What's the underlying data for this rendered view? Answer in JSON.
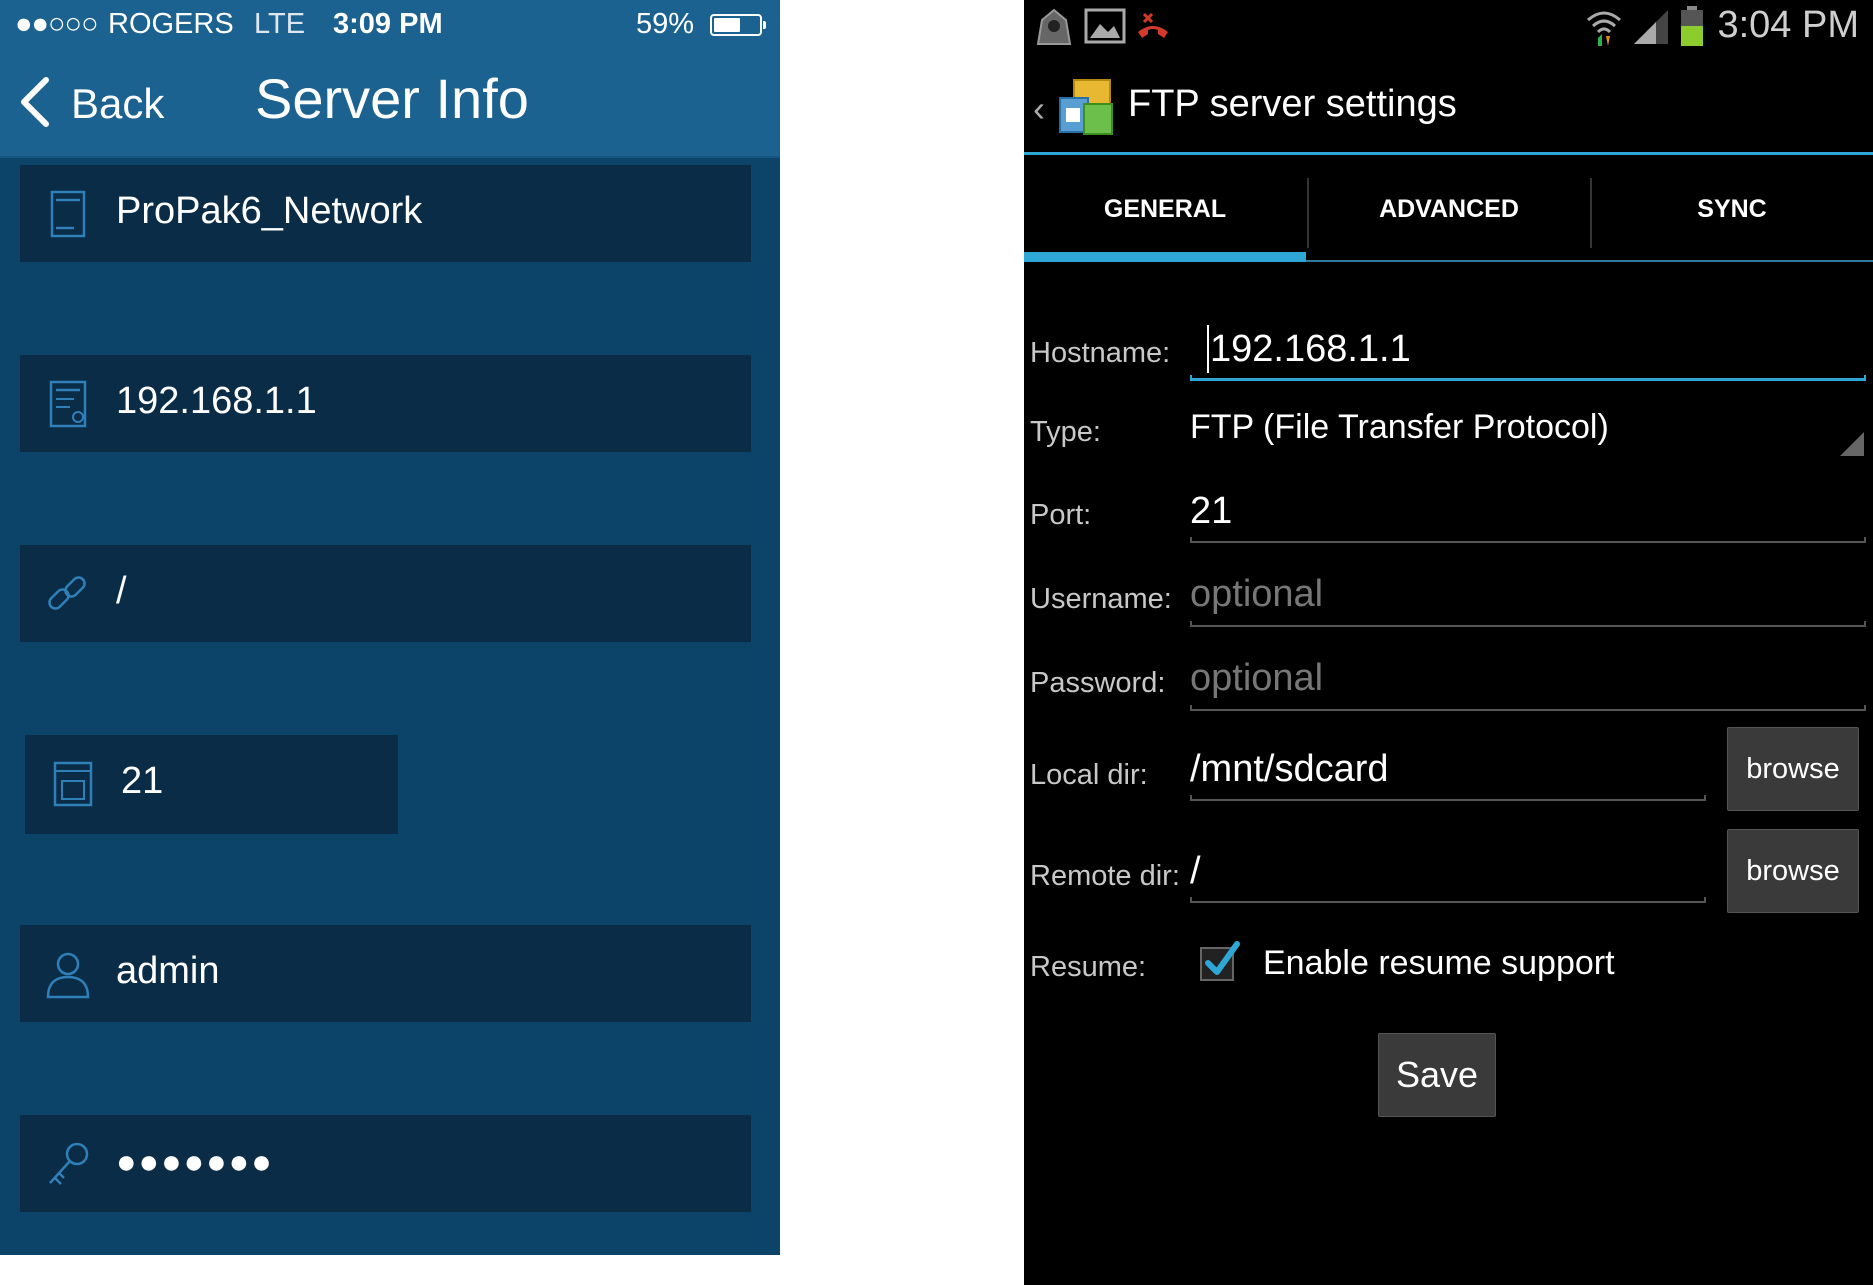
{
  "ios": {
    "status": {
      "signal": "●●○○○",
      "carrier": "ROGERS",
      "network": "LTE",
      "time": "3:09 PM",
      "battery": "59%",
      "battery_level": 0.59
    },
    "nav": {
      "back_label": "Back",
      "title": "Server Info"
    },
    "fields": {
      "server_name": "ProPak6_Network",
      "host": "192.168.1.1",
      "path": "/",
      "port": "21",
      "username": "admin",
      "password": "●●●●●●●"
    },
    "icons": [
      "server-icon",
      "host-icon",
      "link-icon",
      "port-icon",
      "user-icon",
      "key-icon"
    ]
  },
  "android": {
    "status": {
      "time": "3:04 PM"
    },
    "actionbar": {
      "title": "FTP server settings"
    },
    "tabs": [
      {
        "label": "GENERAL",
        "selected": true
      },
      {
        "label": "ADVANCED",
        "selected": false
      },
      {
        "label": "SYNC",
        "selected": false
      }
    ],
    "form": {
      "hostname": {
        "label": "Hostname:",
        "value": "192.168.1.1"
      },
      "type": {
        "label": "Type:",
        "value": "FTP (File Transfer Protocol)"
      },
      "port": {
        "label": "Port:",
        "value": "21"
      },
      "username": {
        "label": "Username:",
        "placeholder": "optional"
      },
      "password": {
        "label": "Password:",
        "placeholder": "optional"
      },
      "local_dir": {
        "label": "Local dir:",
        "value": "/mnt/sdcard",
        "button": "browse"
      },
      "remote_dir": {
        "label": "Remote dir:",
        "value": "/",
        "button": "browse"
      },
      "resume": {
        "label": "Resume:",
        "checkbox_label": "Enable resume support",
        "checked": true
      }
    },
    "save_label": "Save",
    "colors": {
      "accent": "#2fa7d6",
      "ios_bg": "#0c4368",
      "ios_header": "#1b6290",
      "ios_field": "#0a2c46"
    }
  }
}
